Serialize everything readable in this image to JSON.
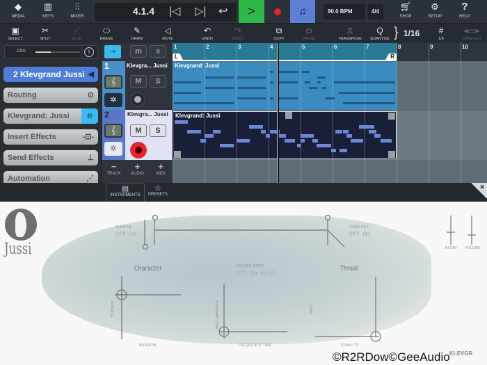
{
  "topbar": {
    "media": "MEDIA",
    "keys": "KEYS",
    "mixer": "MIXER",
    "position": "4.1.4",
    "bpm": "90.0 BPM",
    "time_signature": "4/4",
    "shop": "SHOP",
    "setup": "SETUP",
    "help": "HELP",
    "accent_play": "#2fb84a",
    "accent_metronome": "#5e7fd6"
  },
  "toolbar": {
    "select": "SELECT",
    "split": "SPLIT",
    "glue": "GLUE",
    "erase": "ERASE",
    "draw": "DRAW",
    "mute": "MUTE",
    "undo": "UNDO",
    "redo": "REDO",
    "copy": "COPY",
    "paste": "PASTE",
    "transpose": "TRANSPOSE",
    "quantize": "QUANTIZE",
    "quantize_value": "1/16",
    "grid_value": "1/8",
    "stretch": "STRETCH"
  },
  "inspector": {
    "cpu_label": "CPU",
    "cpu_load": 0.35,
    "track_name": "2 Klevgrand Jussi",
    "routing": "Routing",
    "instrument": "Klevgrand: Jussi",
    "insert_effects": "Insert Effects",
    "send_effects": "Send Effects",
    "automation": "Automation"
  },
  "tracks": [
    {
      "number": "1",
      "name": "Klevgra... Jussi",
      "m": "M",
      "s": "S",
      "clip": "Klevgrand: Jussi",
      "notes": [
        [
          4.04,
          0.12,
          0
        ],
        [
          4.27,
          0.64,
          0
        ],
        [
          5.03,
          0.25,
          0
        ],
        [
          2.02,
          0.89,
          1
        ],
        [
          3.02,
          0.89,
          1
        ],
        [
          5.52,
          0.27,
          1
        ],
        [
          1.04,
          0.86,
          2
        ],
        [
          4.04,
          0.12,
          2
        ],
        [
          4.27,
          0.64,
          2
        ],
        [
          5.14,
          0.16,
          2
        ],
        [
          5.52,
          0.11,
          2
        ],
        [
          6.04,
          1.92,
          2
        ],
        [
          2.02,
          0.89,
          3
        ],
        [
          3.02,
          0.89,
          3
        ],
        [
          5.27,
          0.27,
          3
        ],
        [
          5.66,
          0.15,
          3
        ],
        [
          1.04,
          0.86,
          4
        ],
        [
          6.19,
          1.77,
          4
        ],
        [
          3.02,
          0.89,
          5
        ],
        [
          4.04,
          0.12,
          5
        ],
        [
          4.27,
          0.64,
          5
        ],
        [
          5.79,
          0.28,
          5
        ],
        [
          1.04,
          1.87,
          6
        ],
        [
          6.33,
          1.63,
          6
        ]
      ]
    },
    {
      "number": "2",
      "name": "Klevgra... Jussi",
      "m": "M",
      "s": "S",
      "clip": "Klevgrand: Jussi",
      "notes": [
        [
          1.06,
          0.41,
          0
        ],
        [
          3.4,
          0.43,
          1
        ],
        [
          6.82,
          0.49,
          1
        ],
        [
          1.46,
          0.44,
          2
        ],
        [
          2.26,
          0.25,
          2
        ],
        [
          3.76,
          0.15,
          2
        ],
        [
          4.05,
          0.29,
          2
        ],
        [
          6.08,
          0.22,
          2
        ],
        [
          6.33,
          0.17,
          2
        ],
        [
          7.12,
          0.25,
          2
        ],
        [
          2.01,
          0.27,
          3
        ],
        [
          3.91,
          0.14,
          3
        ],
        [
          4.3,
          0.24,
          3
        ],
        [
          5.01,
          0.4,
          3
        ],
        [
          6.44,
          0.16,
          3
        ],
        [
          7.31,
          0.2,
          3
        ],
        [
          1.88,
          0.16,
          4
        ],
        [
          3.0,
          0.42,
          4
        ],
        [
          4.51,
          0.32,
          4
        ],
        [
          5.01,
          0.11,
          4
        ],
        [
          5.38,
          0.16,
          4
        ],
        [
          6.57,
          0.39,
          4
        ],
        [
          7.51,
          0.34,
          4
        ],
        [
          2.48,
          0.43,
          5
        ],
        [
          4.9,
          0.11,
          5
        ],
        [
          5.51,
          0.44,
          5
        ],
        [
          5.95,
          0.16,
          6
        ],
        [
          6.21,
          0.24,
          6
        ]
      ]
    }
  ],
  "track_controls": {
    "track": "TRACK",
    "audio": "AUDIO",
    "midi": "MIDI"
  },
  "ruler": {
    "bars": [
      "1",
      "2",
      "3",
      "4",
      "5",
      "6",
      "7",
      "8",
      "9",
      "10"
    ],
    "loop_left": "L",
    "loop_right": "R",
    "loop_start_bar": 1,
    "loop_end_bar": 8,
    "playhead_bar": 4.3
  },
  "bottom_tabs": {
    "instruments": "INSTRUMENTS",
    "presets": "PRESETS"
  },
  "plugin": {
    "name": "Jussi",
    "brand": "KLEVGR",
    "turn_in": "TURN IN",
    "turn_in_opts": "Off On",
    "legato": "LEGATO STATE",
    "legato_opts": "Off On Hold",
    "turn_out": "TURN OUT",
    "turn_out_opts": "Off On",
    "character": "Character",
    "throat": "Throat",
    "intense": "INTENSE",
    "narrow": "NARROW",
    "formant_time": "FORMANT TIME",
    "frequency_time": "FREQUENCY TIME",
    "gain": "GAIN",
    "tonality": "TONALITY",
    "room": "ROOM",
    "volume": "VOLUME"
  },
  "watermark": "©R2RDow©GeeAudio"
}
